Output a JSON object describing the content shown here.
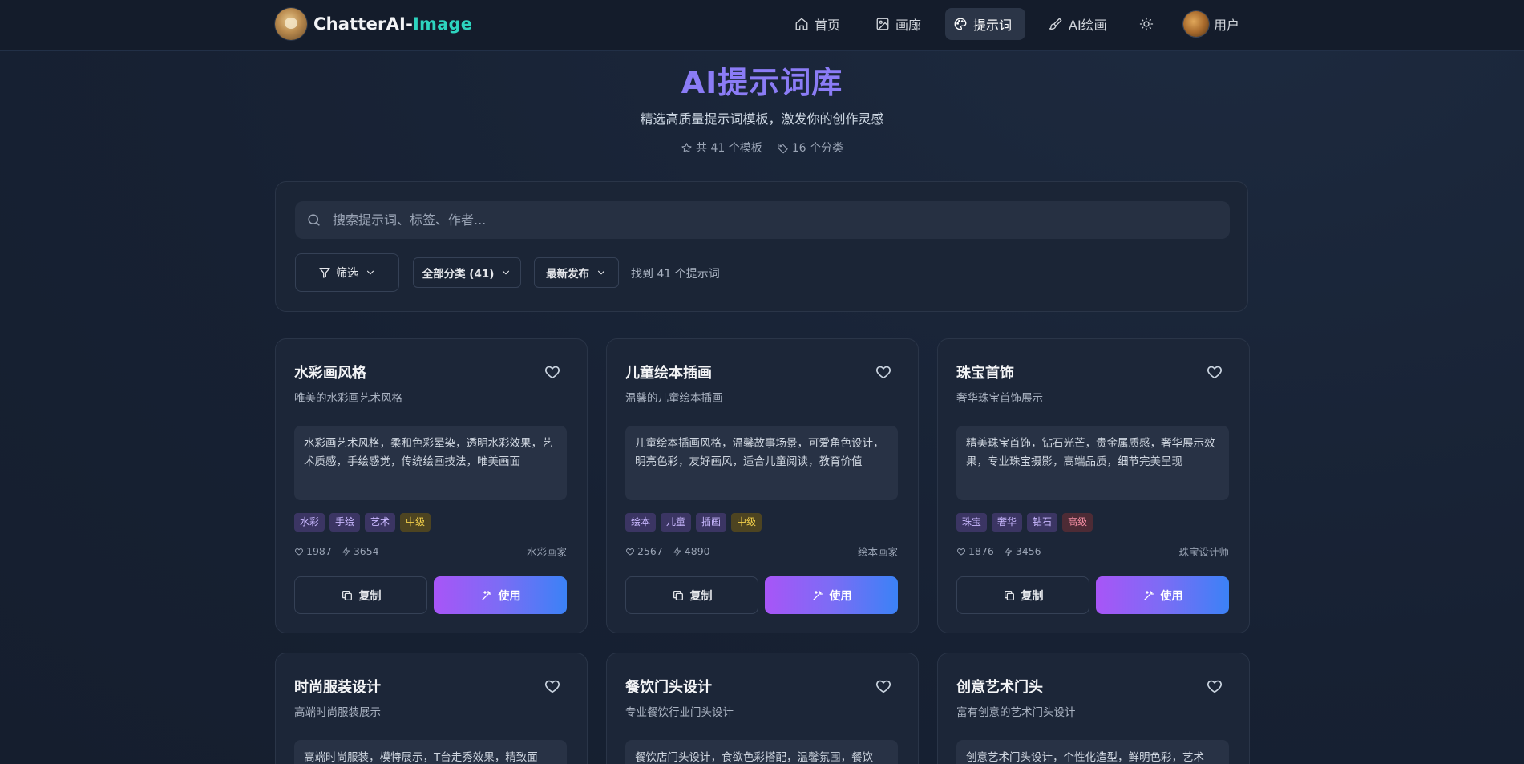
{
  "brand": {
    "name_main": "ChatterAI-",
    "name_accent": "Image"
  },
  "nav": {
    "items": [
      {
        "label": "首页",
        "icon": "home-icon"
      },
      {
        "label": "画廊",
        "icon": "image-icon"
      },
      {
        "label": "提示词",
        "icon": "palette-icon",
        "active": true
      },
      {
        "label": "AI绘画",
        "icon": "brush-icon"
      }
    ],
    "theme_toggle_icon": "sun-icon",
    "user_label": "用户"
  },
  "hero": {
    "title": "AI提示词库",
    "subtitle": "精选高质量提示词模板，激发你的创作灵感",
    "stat_templates": "共 41 个模板",
    "stat_categories": "16 个分类"
  },
  "filters": {
    "search_placeholder": "搜索提示词、标签、作者...",
    "filter_label": "筛选",
    "category_label": "全部分类 (41)",
    "sort_label": "最新发布",
    "result_text": "找到 41 个提示词"
  },
  "cards": [
    {
      "title": "水彩画风格",
      "subtitle": "唯美的水彩画艺术风格",
      "prompt": "水彩画艺术风格，柔和色彩晕染，透明水彩效果，艺术质感，手绘感觉，传统绘画技法，唯美画面",
      "tags": [
        {
          "label": "水彩",
          "tone": "purple"
        },
        {
          "label": "手绘",
          "tone": "purple"
        },
        {
          "label": "艺术",
          "tone": "purple"
        },
        {
          "label": "中级",
          "tone": "yellow"
        }
      ],
      "likes": "1987",
      "uses": "3654",
      "author": "水彩画家",
      "copy_label": "复制",
      "use_label": "使用"
    },
    {
      "title": "儿童绘本插画",
      "subtitle": "温馨的儿童绘本插画",
      "prompt": "儿童绘本插画风格，温馨故事场景，可爱角色设计，明亮色彩，友好画风，适合儿童阅读，教育价值",
      "tags": [
        {
          "label": "绘本",
          "tone": "purple"
        },
        {
          "label": "儿童",
          "tone": "purple"
        },
        {
          "label": "插画",
          "tone": "purple"
        },
        {
          "label": "中级",
          "tone": "yellow"
        }
      ],
      "likes": "2567",
      "uses": "4890",
      "author": "绘本画家",
      "copy_label": "复制",
      "use_label": "使用"
    },
    {
      "title": "珠宝首饰",
      "subtitle": "奢华珠宝首饰展示",
      "prompt": "精美珠宝首饰，钻石光芒，贵金属质感，奢华展示效果，专业珠宝摄影，高端品质，细节完美呈现",
      "tags": [
        {
          "label": "珠宝",
          "tone": "purple"
        },
        {
          "label": "奢华",
          "tone": "purple"
        },
        {
          "label": "钻石",
          "tone": "purple"
        },
        {
          "label": "高级",
          "tone": "red"
        }
      ],
      "likes": "1876",
      "uses": "3456",
      "author": "珠宝设计师",
      "copy_label": "复制",
      "use_label": "使用"
    },
    {
      "title": "时尚服装设计",
      "subtitle": "高端时尚服装展示",
      "prompt": "高端时尚服装，模特展示，T台走秀效果，精致面"
    },
    {
      "title": "餐饮门头设计",
      "subtitle": "专业餐饮行业门头设计",
      "prompt": "餐饮店门头设计，食欲色彩搭配，温馨氛围，餐饮"
    },
    {
      "title": "创意艺术门头",
      "subtitle": "富有创意的艺术门头设计",
      "prompt": "创意艺术门头设计，个性化造型，鲜明色彩，艺术"
    }
  ]
}
